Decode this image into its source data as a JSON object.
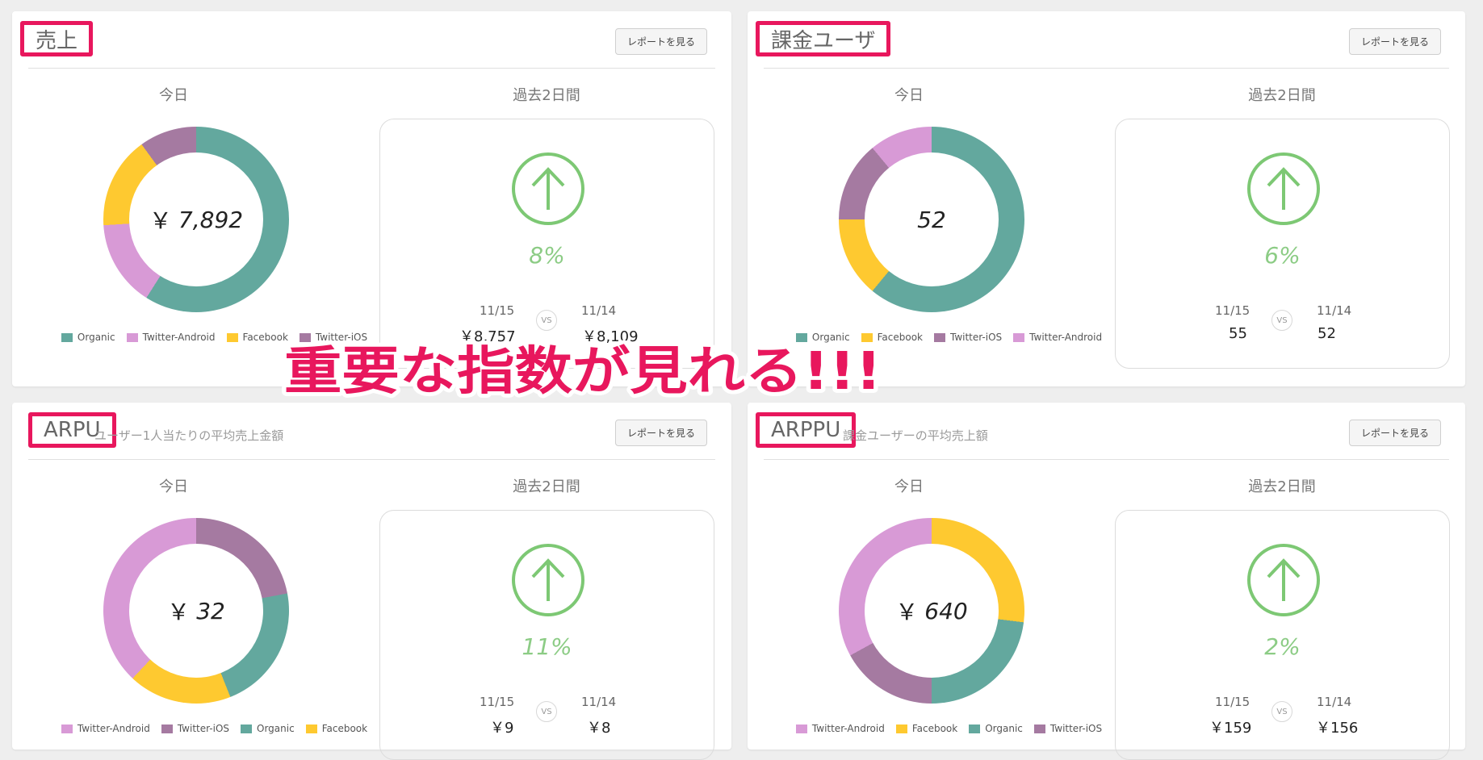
{
  "colors": {
    "organic": "#63a89e",
    "twitter_android": "#d89ad6",
    "facebook": "#fec930",
    "twitter_ios": "#a57aa1",
    "accent": "#e8175d",
    "up": "#7dc874"
  },
  "common": {
    "report_button": "レポートを見る",
    "today": "今日",
    "past": "過去2日間",
    "vs": "VS",
    "date_a": "11/15",
    "date_b": "11/14"
  },
  "cards": [
    {
      "title": "売上",
      "subtitle": "",
      "center_prefix": "￥",
      "center_value": "7,892",
      "pct": "8%",
      "val_a": "￥8,757",
      "val_b": "￥8,109",
      "legend": [
        "Organic",
        "Twitter-Android",
        "Facebook",
        "Twitter-iOS"
      ],
      "segments": [
        {
          "key": "organic",
          "value": 0.59
        },
        {
          "key": "twitter_android",
          "value": 0.15
        },
        {
          "key": "facebook",
          "value": 0.16
        },
        {
          "key": "twitter_ios",
          "value": 0.1
        }
      ]
    },
    {
      "title": "課金ユーザ",
      "subtitle": "",
      "center_prefix": "",
      "center_value": "52",
      "pct": "6%",
      "val_a": "55",
      "val_b": "52",
      "legend": [
        "Organic",
        "Facebook",
        "Twitter-iOS",
        "Twitter-Android"
      ],
      "segments": [
        {
          "key": "organic",
          "value": 0.61
        },
        {
          "key": "facebook",
          "value": 0.14
        },
        {
          "key": "twitter_ios",
          "value": 0.14
        },
        {
          "key": "twitter_android",
          "value": 0.11
        }
      ]
    },
    {
      "title": "ARPU",
      "subtitle": "ユーザー1人当たりの平均売上金額",
      "center_prefix": "￥",
      "center_value": "32",
      "pct": "11%",
      "val_a": "￥9",
      "val_b": "￥8",
      "legend": [
        "Twitter-Android",
        "Twitter-iOS",
        "Organic",
        "Facebook"
      ],
      "segments": [
        {
          "key": "twitter_ios",
          "value": 0.22
        },
        {
          "key": "organic",
          "value": 0.22
        },
        {
          "key": "facebook",
          "value": 0.18
        },
        {
          "key": "twitter_android",
          "value": 0.38
        }
      ]
    },
    {
      "title": "ARPPU",
      "subtitle": "課金ユーザーの平均売上額",
      "center_prefix": "￥",
      "center_value": "640",
      "pct": "2%",
      "val_a": "￥159",
      "val_b": "￥156",
      "legend": [
        "Twitter-Android",
        "Facebook",
        "Organic",
        "Twitter-iOS"
      ],
      "segments": [
        {
          "key": "facebook",
          "value": 0.27
        },
        {
          "key": "organic",
          "value": 0.23
        },
        {
          "key": "twitter_ios",
          "value": 0.17
        },
        {
          "key": "twitter_android",
          "value": 0.33
        }
      ]
    }
  ],
  "banner": "重要な指数が見れる!!!"
}
